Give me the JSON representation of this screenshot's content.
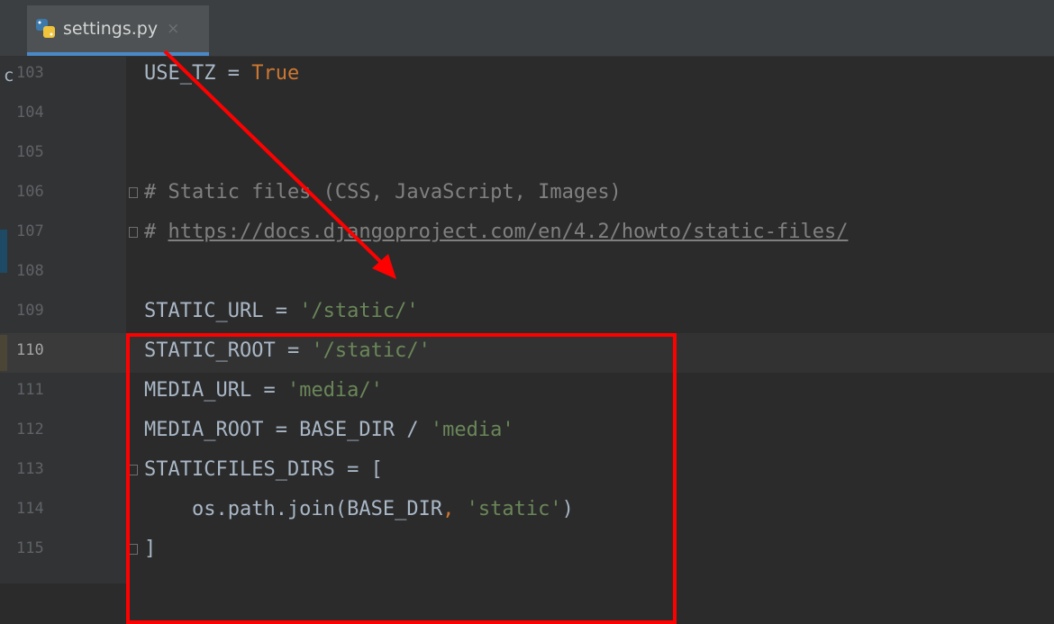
{
  "tab": {
    "label": "settings.py",
    "close": "×"
  },
  "left_edge_char": "c",
  "lines": [
    {
      "num": "103",
      "parts": [
        {
          "t": "USE_TZ = ",
          "c": "plain"
        },
        {
          "t": "True",
          "c": "kw"
        }
      ]
    },
    {
      "num": "104",
      "parts": []
    },
    {
      "num": "105",
      "parts": []
    },
    {
      "num": "106",
      "parts": [
        {
          "t": "# Static files (CSS, JavaScript, Images)",
          "c": "cmt"
        }
      ]
    },
    {
      "num": "107",
      "parts": [
        {
          "t": "# ",
          "c": "cmt"
        },
        {
          "t": "https://docs.djangoproject.com/en/4.2/howto/static-files/",
          "c": "url"
        }
      ]
    },
    {
      "num": "108",
      "parts": []
    },
    {
      "num": "109",
      "parts": [
        {
          "t": "STATIC_URL = ",
          "c": "plain"
        },
        {
          "t": "'/static/'",
          "c": "str"
        }
      ]
    },
    {
      "num": "110",
      "parts": [
        {
          "t": "STATIC_ROOT = ",
          "c": "plain"
        },
        {
          "t": "'/static/'",
          "c": "str"
        }
      ]
    },
    {
      "num": "111",
      "parts": [
        {
          "t": "MEDIA_URL = ",
          "c": "plain"
        },
        {
          "t": "'media/'",
          "c": "str"
        }
      ]
    },
    {
      "num": "112",
      "parts": [
        {
          "t": "MEDIA_ROOT = BASE_DIR / ",
          "c": "plain"
        },
        {
          "t": "'media'",
          "c": "str"
        }
      ]
    },
    {
      "num": "113",
      "parts": [
        {
          "t": "STATICFILES_DIRS = [",
          "c": "plain"
        }
      ]
    },
    {
      "num": "114",
      "parts": [
        {
          "t": "    os.path.join(BASE_DIR",
          "c": "plain"
        },
        {
          "t": ", ",
          "c": "kw"
        },
        {
          "t": "'static'",
          "c": "str"
        },
        {
          "t": ")",
          "c": "plain"
        }
      ]
    },
    {
      "num": "115",
      "parts": [
        {
          "t": "]",
          "c": "plain"
        }
      ]
    }
  ],
  "current_line": "110",
  "colors": {
    "background": "#2b2b2b",
    "string": "#6a8759",
    "keyword": "#cc7832",
    "comment": "#808080",
    "annotation": "#ff0000"
  }
}
